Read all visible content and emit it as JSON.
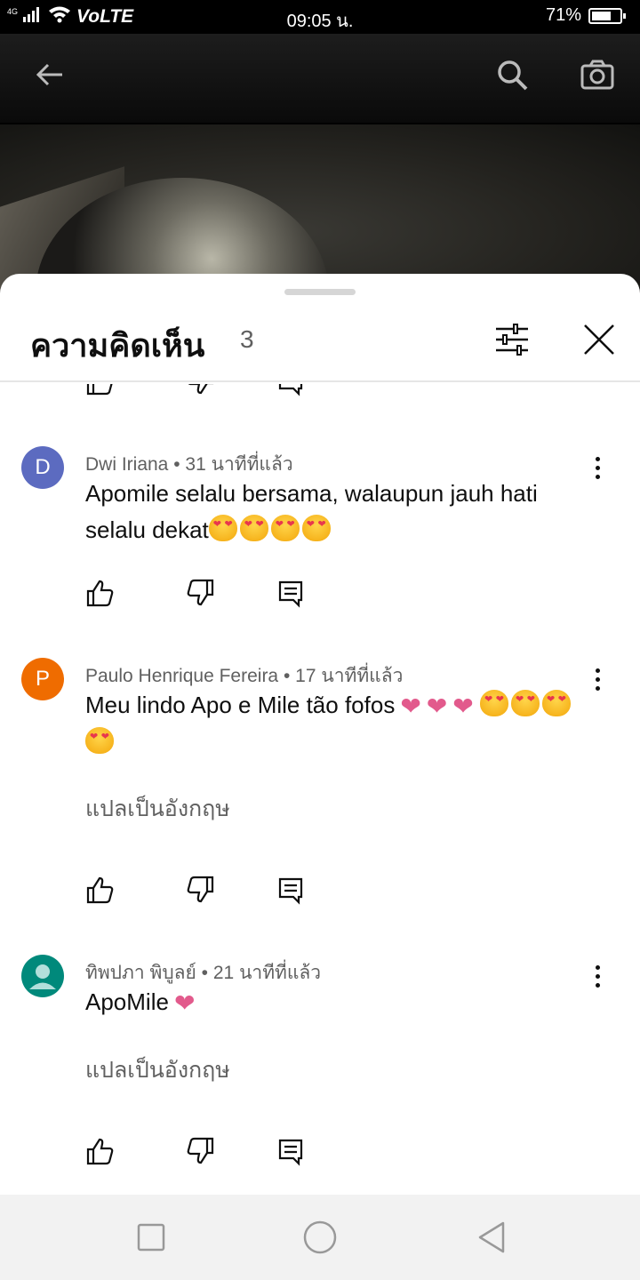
{
  "status_bar": {
    "network": "4G",
    "carrier_label": "VoLTE",
    "time": "09:05 น.",
    "battery_percent": "71%",
    "battery_level": 0.71
  },
  "video": {
    "back_icon": "arrow-left-icon",
    "search_icon": "search-icon",
    "camera_icon": "camera-icon"
  },
  "comments_panel": {
    "title": "ความคิดเห็น",
    "count": "3",
    "filter_icon": "sliders-icon",
    "close_icon": "close-icon"
  },
  "comments": [
    {
      "author": "Dwi Iriana",
      "avatar_letter": "D",
      "avatar_color": "#5c6bc0",
      "time": "31 นาทีที่แล้ว",
      "text": "Apomile selalu bersama, walaupun jauh hati selalu dekat",
      "emoji_faces": 4,
      "emoji_hearts": 0,
      "translate_label": ""
    },
    {
      "author": "Paulo Henrique Fereira",
      "avatar_letter": "P",
      "avatar_color": "#ef6c00",
      "time": "17 นาทีที่แล้ว",
      "text": "Meu lindo Apo e Mile tão fofos",
      "emoji_hearts": 3,
      "emoji_faces": 4,
      "translate_label": "แปลเป็นอังกฤษ"
    },
    {
      "author": "ทิพปภา พิบูลย์",
      "avatar_letter": "",
      "avatar_color": "#00897b",
      "time": "21 นาทีที่แล้ว",
      "text": "ApoMile",
      "emoji_hearts": 1,
      "emoji_faces": 0,
      "translate_label": "แปลเป็นอังกฤษ"
    }
  ],
  "comment_actions": {
    "like_icon": "thumbs-up-icon",
    "dislike_icon": "thumbs-down-icon",
    "reply_icon": "reply-icon"
  },
  "nav_bar": {
    "recents_icon": "square-icon",
    "home_icon": "circle-icon",
    "back_icon": "triangle-back-icon"
  }
}
